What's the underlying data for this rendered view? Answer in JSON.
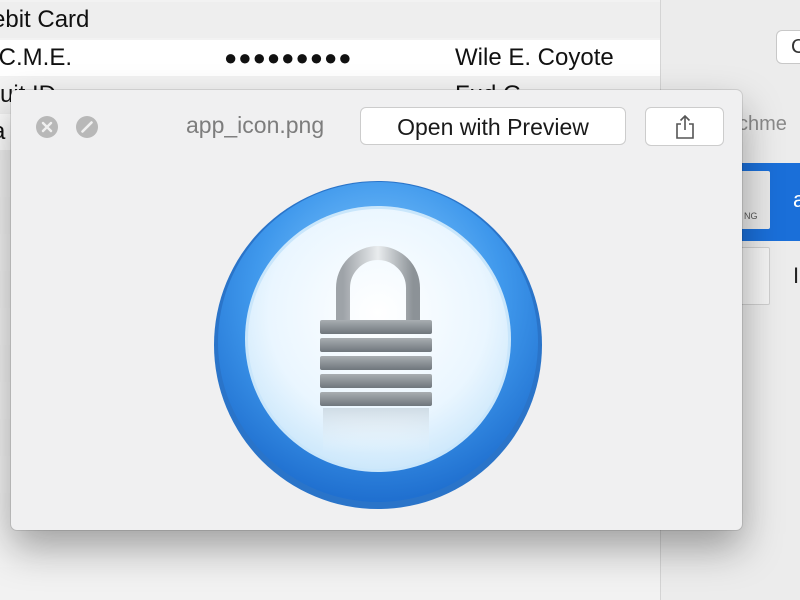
{
  "background_list": {
    "rows": [
      {
        "name": "ebit Card",
        "value": "",
        "owner": ""
      },
      {
        "name": ".C.M.E.",
        "value": "●●●●●●●●●",
        "owner": "Wile E. Coyote"
      },
      {
        "name": "ruit ID",
        "value": "",
        "owner": "Fud G"
      },
      {
        "name": "a",
        "value": "",
        "owner": ""
      }
    ]
  },
  "side_panel": {
    "button_label": "C",
    "attachments_label": "chme",
    "items": [
      {
        "label": "a",
        "badge": "NG",
        "icon": "png-file-icon"
      },
      {
        "label": "I",
        "icon": "document-file-icon"
      }
    ]
  },
  "quick_look": {
    "title": "app_icon.png",
    "open_button_label": "Open with Preview",
    "share_icon": "share-icon",
    "close_icon": "close-icon",
    "fullscreen_icon": "fullscreen-icon",
    "preview_icon": "padlock-app-icon"
  },
  "colors": {
    "selection_blue": "#1a6fd9",
    "icon_ring_blue": "#2e86e6",
    "icon_center": "#f3fbff",
    "lock_metal": "#8a9096"
  }
}
